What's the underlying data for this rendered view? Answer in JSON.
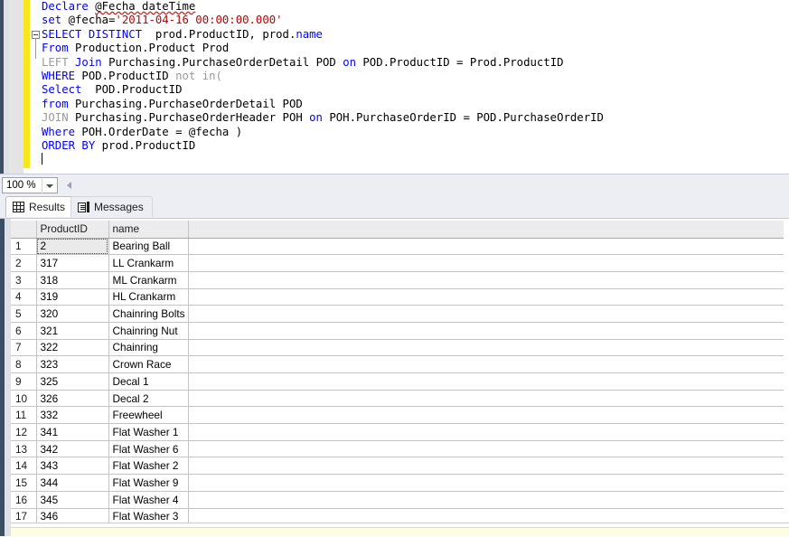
{
  "editor": {
    "zoom_level": "100 %",
    "lines": [
      {
        "id": "l1",
        "fold": false,
        "tokens": [
          {
            "t": "Declare ",
            "c": "kw"
          },
          {
            "t": "@Fecha dateTime",
            "c": "idn squiggle"
          }
        ]
      },
      {
        "id": "l2",
        "fold": false,
        "tokens": [
          {
            "t": "set ",
            "c": "kw"
          },
          {
            "t": "@fecha=",
            "c": "idn"
          },
          {
            "t": "'2011-04-16 00:00:00.000'",
            "c": "str"
          }
        ]
      },
      {
        "id": "l3",
        "fold": true,
        "tokens": [
          {
            "t": "SELECT DISTINCT ",
            "c": "kw"
          },
          {
            "t": " prod.ProductID, prod.",
            "c": "idn"
          },
          {
            "t": "name",
            "c": "kw"
          }
        ]
      },
      {
        "id": "l4",
        "fold": false,
        "tokens": [
          {
            "t": "From ",
            "c": "kw"
          },
          {
            "t": "Production.Product Prod",
            "c": "idn"
          }
        ]
      },
      {
        "id": "l5",
        "fold": false,
        "tokens": [
          {
            "t": "LEFT ",
            "c": "kwg"
          },
          {
            "t": "Join ",
            "c": "kw"
          },
          {
            "t": "Purchasing.PurchaseOrderDetail POD ",
            "c": "idn"
          },
          {
            "t": "on ",
            "c": "kw"
          },
          {
            "t": "POD.ProductID = Prod.ProductID",
            "c": "idn"
          }
        ]
      },
      {
        "id": "l6",
        "fold": false,
        "tokens": [
          {
            "t": "WHERE ",
            "c": "kw"
          },
          {
            "t": "POD.ProductID ",
            "c": "idn"
          },
          {
            "t": "not in(",
            "c": "kwg"
          }
        ]
      },
      {
        "id": "l7",
        "fold": false,
        "tokens": [
          {
            "t": "Select ",
            "c": "kw"
          },
          {
            "t": " POD.ProductID",
            "c": "idn"
          }
        ]
      },
      {
        "id": "l8",
        "fold": false,
        "tokens": [
          {
            "t": "from ",
            "c": "kw"
          },
          {
            "t": "Purchasing.PurchaseOrderDetail POD",
            "c": "idn"
          }
        ]
      },
      {
        "id": "l9",
        "fold": false,
        "tokens": [
          {
            "t": "JOIN ",
            "c": "kwg"
          },
          {
            "t": "Purchasing.PurchaseOrderHeader POH ",
            "c": "idn"
          },
          {
            "t": "on ",
            "c": "kw"
          },
          {
            "t": "POH.PurchaseOrderID = POD.PurchaseOrderID",
            "c": "idn"
          }
        ]
      },
      {
        "id": "l10",
        "fold": false,
        "tokens": [
          {
            "t": "Where ",
            "c": "kw"
          },
          {
            "t": "POH.OrderDate = @fecha )",
            "c": "idn"
          }
        ]
      },
      {
        "id": "l11",
        "fold": false,
        "tokens": [
          {
            "t": "ORDER BY ",
            "c": "kw"
          },
          {
            "t": "prod.ProductID",
            "c": "idn"
          }
        ]
      },
      {
        "id": "l12",
        "fold": false,
        "caret": true,
        "tokens": []
      }
    ]
  },
  "tabs": [
    {
      "key": "results",
      "label": "Results",
      "icon": "grid-icon",
      "active": true
    },
    {
      "key": "messages",
      "label": "Messages",
      "icon": "message-icon",
      "active": false
    }
  ],
  "results": {
    "columns": [
      "",
      "ProductID",
      "name"
    ],
    "rows": [
      {
        "n": "1",
        "ProductID": "2",
        "name": "Bearing Ball",
        "selected": true
      },
      {
        "n": "2",
        "ProductID": "317",
        "name": "LL Crankarm",
        "selected": false
      },
      {
        "n": "3",
        "ProductID": "318",
        "name": "ML Crankarm",
        "selected": false
      },
      {
        "n": "4",
        "ProductID": "319",
        "name": "HL Crankarm",
        "selected": false
      },
      {
        "n": "5",
        "ProductID": "320",
        "name": "Chainring Bolts",
        "selected": false
      },
      {
        "n": "6",
        "ProductID": "321",
        "name": "Chainring Nut",
        "selected": false
      },
      {
        "n": "7",
        "ProductID": "322",
        "name": "Chainring",
        "selected": false
      },
      {
        "n": "8",
        "ProductID": "323",
        "name": "Crown Race",
        "selected": false
      },
      {
        "n": "9",
        "ProductID": "325",
        "name": "Decal 1",
        "selected": false
      },
      {
        "n": "10",
        "ProductID": "326",
        "name": "Decal 2",
        "selected": false
      },
      {
        "n": "11",
        "ProductID": "332",
        "name": "Freewheel",
        "selected": false
      },
      {
        "n": "12",
        "ProductID": "341",
        "name": "Flat Washer 1",
        "selected": false
      },
      {
        "n": "13",
        "ProductID": "342",
        "name": "Flat Washer 6",
        "selected": false
      },
      {
        "n": "14",
        "ProductID": "343",
        "name": "Flat Washer 2",
        "selected": false
      },
      {
        "n": "15",
        "ProductID": "344",
        "name": "Flat Washer 9",
        "selected": false
      },
      {
        "n": "16",
        "ProductID": "345",
        "name": "Flat Washer 4",
        "selected": false
      },
      {
        "n": "17",
        "ProductID": "346",
        "name": "Flat Washer 3",
        "selected": false
      }
    ]
  },
  "colors": {
    "keyword": "#0000ff",
    "keyword_dim": "#9a9a9a",
    "string": "#c00000",
    "identifier": "#000000",
    "change_bar": "#f8e71c",
    "edge_strip": "#3c4f63",
    "chrome": "#eceef3"
  }
}
